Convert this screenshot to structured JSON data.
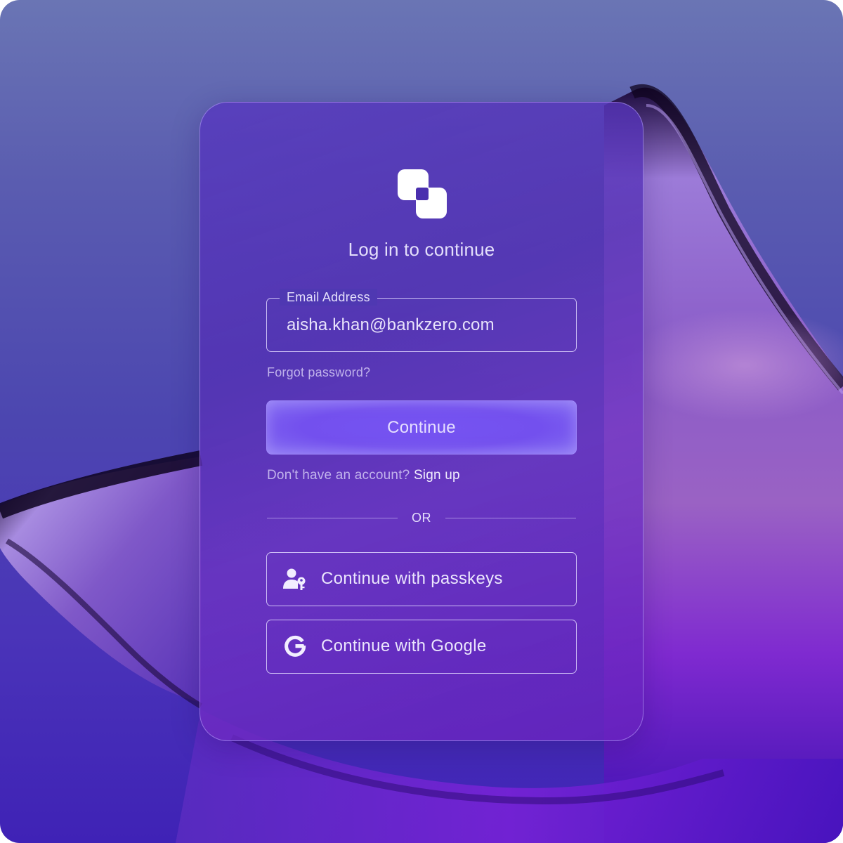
{
  "colors": {
    "background_top": "#6a75b4",
    "background_bottom": "#3f22b6",
    "card": "#5638be",
    "primary_button": "#7654f2",
    "text": "#ece8ff"
  },
  "logo": {
    "icon": "overlapping-squares-logo"
  },
  "login": {
    "title": "Log in to continue",
    "email_label": "Email Address",
    "email_value": "aisha.khan@bankzero.com",
    "forgot_password": "Forgot password?",
    "continue_label": "Continue",
    "signup_prompt": "Don't have an account?",
    "signup_link": "Sign up",
    "divider_text": "OR",
    "passkeys_label": "Continue with passkeys",
    "passkeys_icon": "user-key-icon",
    "google_label": "Continue with Google",
    "google_icon": "google-g-icon"
  }
}
